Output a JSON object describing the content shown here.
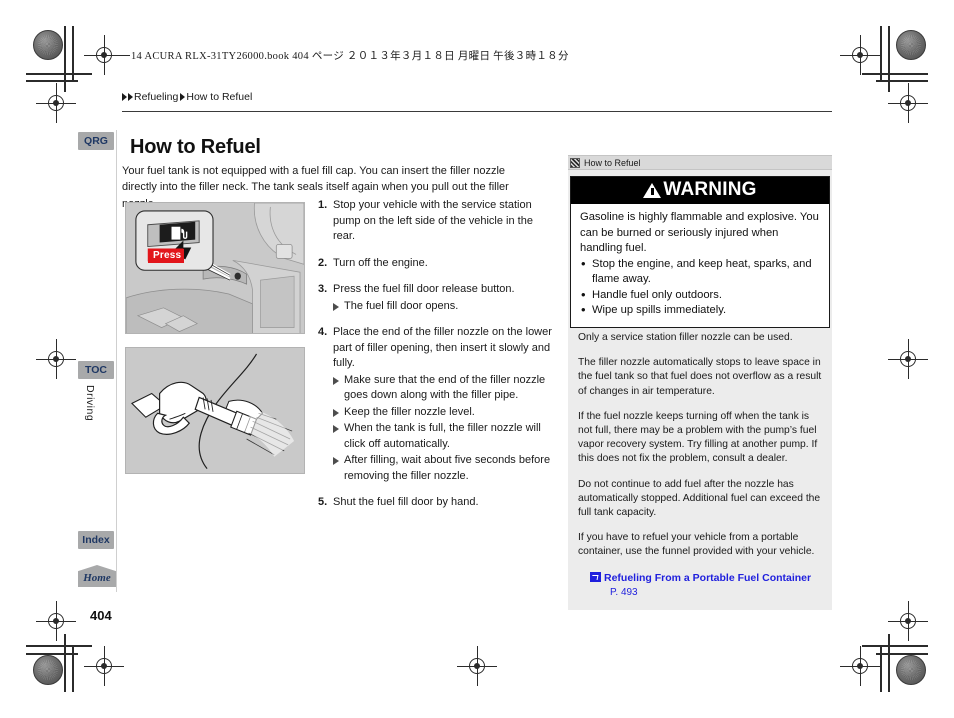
{
  "print_header": "14 ACURA RLX-31TY26000.book   404 ページ   ２０１３年３月１８日   月曜日   午後３時１８分",
  "breadcrumb": {
    "item1": "Refueling",
    "item2": "How to Refuel"
  },
  "page_title": "How to Refuel",
  "page_number": "404",
  "sidebar": {
    "qrg": "QRG",
    "toc": "TOC",
    "index": "Index",
    "home": "Home",
    "chapter": "Driving"
  },
  "intro": "Your fuel tank is not equipped with a fuel fill cap. You can insert the filler nozzle directly into the filler neck. The tank seals itself again when you pull out the filler nozzle.",
  "figures": {
    "fuel_door_button": {
      "press_label": "Press"
    },
    "filler_nozzle": {}
  },
  "steps": [
    {
      "num": "1.",
      "text": "Stop your vehicle with the service station pump on the left side of the vehicle in the rear.",
      "subs": []
    },
    {
      "num": "2.",
      "text": "Turn off the engine.",
      "subs": []
    },
    {
      "num": "3.",
      "text": "Press the fuel fill door release button.",
      "subs": [
        "The fuel fill door opens."
      ]
    },
    {
      "num": "4.",
      "text": "Place the end of the filler nozzle on the lower part of filler opening, then insert it slowly and fully.",
      "subs": [
        "Make sure that the end of the filler nozzle goes down along with the filler pipe.",
        "Keep the filler nozzle level.",
        "When the tank is full, the filler nozzle will click off automatically.",
        "After filling, wait about five seconds before removing the filler nozzle."
      ]
    },
    {
      "num": "5.",
      "text": "Shut the fuel fill door by hand.",
      "subs": []
    }
  ],
  "side_panel": {
    "header": "How to Refuel",
    "warning": {
      "title": "WARNING",
      "lead": "Gasoline is highly flammable and explosive. You can be burned or seriously injured when handling fuel.",
      "bullets": [
        "Stop the engine, and keep heat, sparks, and flame away.",
        "Handle fuel only outdoors.",
        "Wipe up spills immediately."
      ]
    },
    "notes": [
      "Only a service station filler nozzle can be used.",
      "The filler nozzle automatically stops to leave space in the fuel tank so that fuel does not overflow as a result of changes in air temperature.",
      "If the fuel nozzle keeps turning off when the tank is not full, there may be a problem with the pump’s fuel vapor recovery system. Try filling at another pump. If this does not fix the problem, consult a dealer.",
      "Do not continue to add fuel after the nozzle has automatically stopped. Additional fuel can exceed the full tank capacity.",
      "If you have to refuel your vehicle from a portable container, use the funnel provided with your vehicle."
    ],
    "xref": {
      "label": "Refueling From a Portable Fuel Container",
      "page": "P. 493"
    }
  },
  "colors": {
    "accent_link": "#1f1fdd",
    "warning_bar": "#000000",
    "press_label": "#e2161b",
    "tab_bg": "#a8a9aa",
    "tab_text": "#1f3864",
    "side_panel_bg": "#ececec"
  }
}
